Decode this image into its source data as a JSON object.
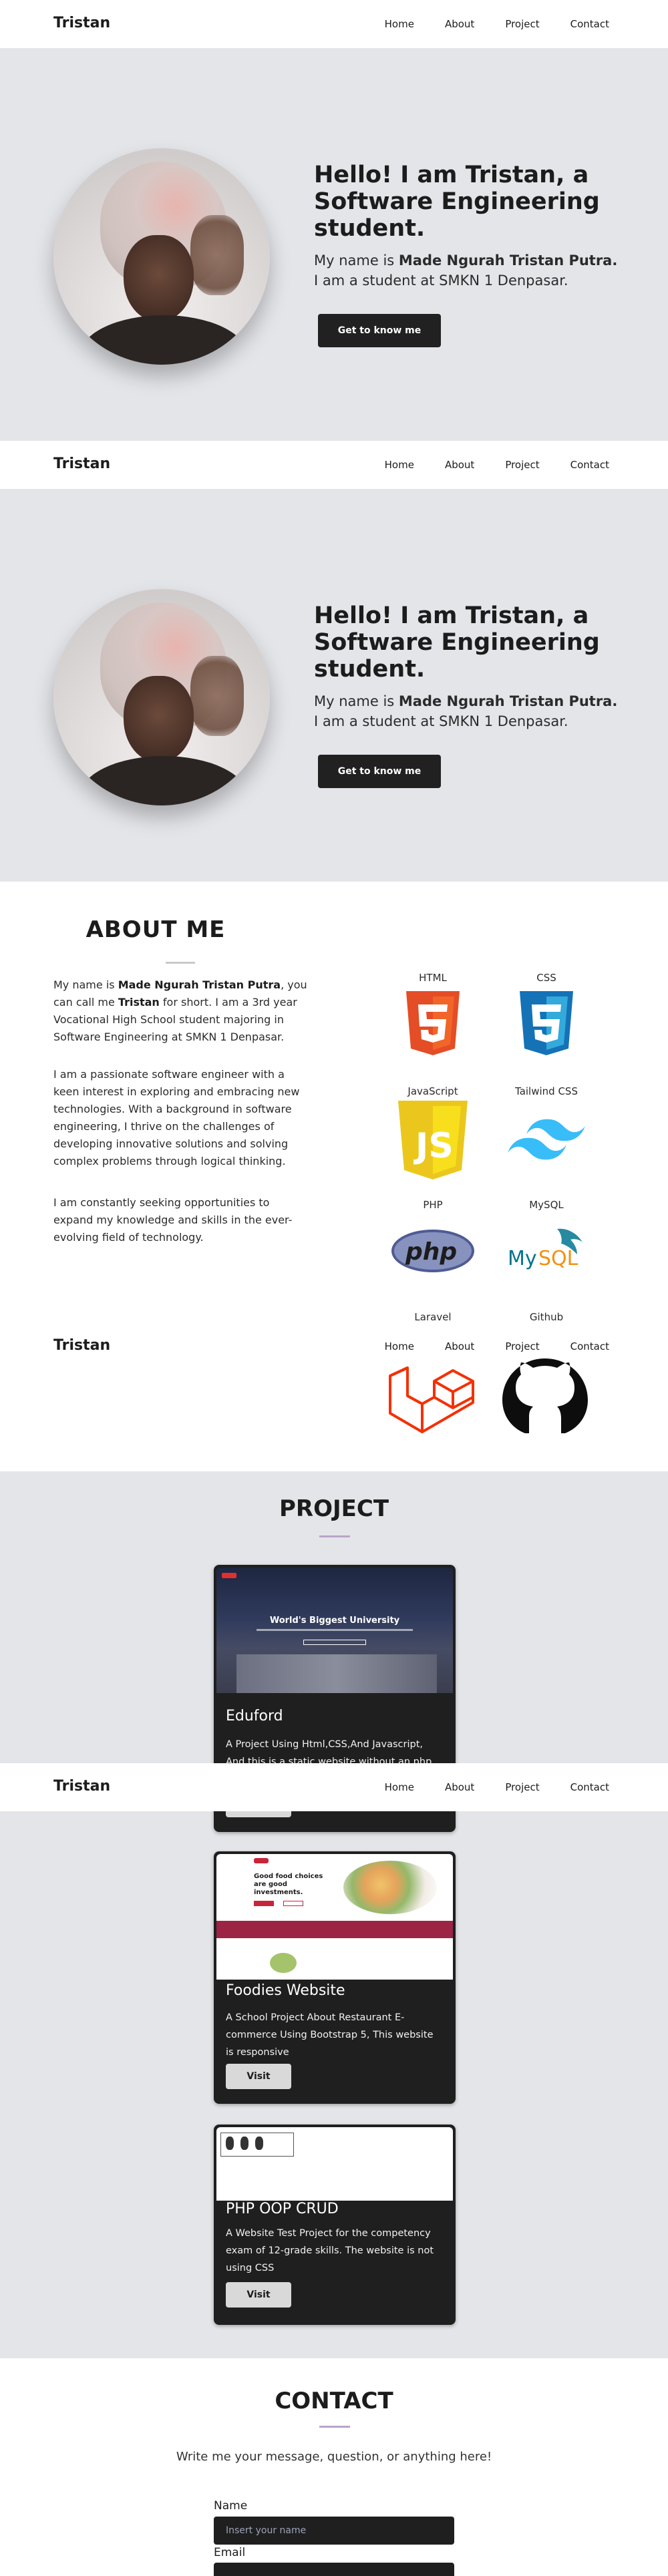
{
  "nav": {
    "brand": "Tristan",
    "links": [
      "Home",
      "About",
      "Project",
      "Contact"
    ]
  },
  "hero": {
    "title": "Hello! I am Tristan, a Software Engineering student.",
    "sub_prefix": "My name is ",
    "sub_name": "Made Ngurah Tristan Putra.",
    "sub_line2": "I am a student at SMKN 1 Denpasar.",
    "button": "Get to know me"
  },
  "about": {
    "title": "ABOUT ME",
    "p1_a": "My name is ",
    "p1_name": "Made Ngurah Tristan Putra",
    "p1_b": ", you can call me ",
    "p1_nick": "Tristan",
    "p1_c": " for short. I am a 3rd year Vocational High School student majoring in Software Engineering at SMKN 1 Denpasar.",
    "p2": "I am a passionate software engineer with a keen interest in exploring and embracing new technologies. With a background in software engineering, I thrive on the challenges of developing innovative solutions and solving complex problems through logical thinking.",
    "p3": "I am constantly seeking opportunities to expand my knowledge and skills in the ever-evolving field of technology.",
    "skills": [
      "HTML",
      "CSS",
      "JavaScript",
      "Tailwind CSS",
      "PHP",
      "MySQL",
      "Laravel",
      "Github"
    ]
  },
  "project": {
    "title": "PROJECT",
    "cards": [
      {
        "title": "Eduford",
        "desc": "A Project Using Html,CSS,And Javascript, And this is a static website without an php",
        "button": "Visit",
        "preview_heading": "World's Biggest University"
      },
      {
        "title": "Foodies Website",
        "desc": "A School Project About Restaurant E-commerce Using Bootstrap 5, This website is responsive",
        "button": "Visit",
        "preview_heading": "Good food choices are good investments."
      },
      {
        "title": "PHP OOP CRUD",
        "desc": "A Website Test Project for the competency exam of 12-grade skills. The website is not using CSS",
        "button": "Visit"
      }
    ]
  },
  "contact": {
    "title": "CONTACT",
    "subtitle": "Write me your message, question, or anything here!",
    "name_label": "Name",
    "name_placeholder": "Insert your name",
    "email_label": "Email"
  }
}
